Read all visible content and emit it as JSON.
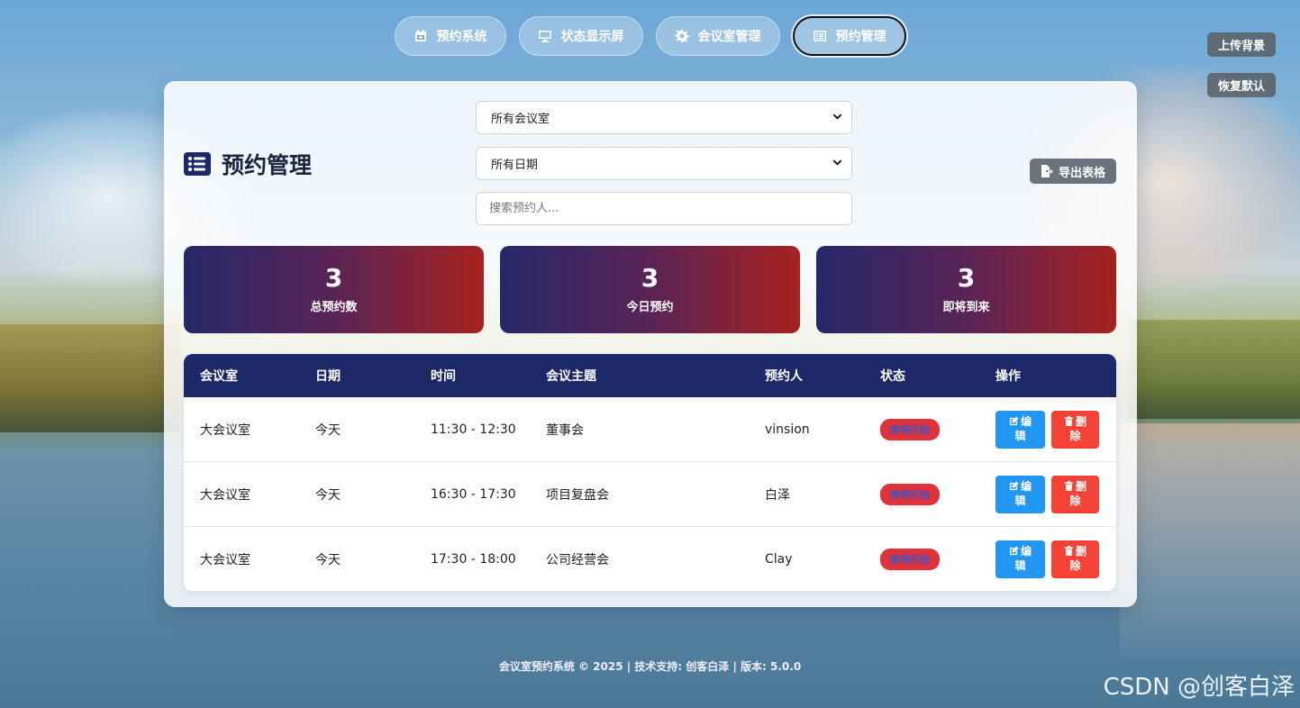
{
  "nav": {
    "items": [
      {
        "label": "预约系统",
        "icon": "calendar-icon"
      },
      {
        "label": "状态显示屏",
        "icon": "monitor-icon"
      },
      {
        "label": "会议室管理",
        "icon": "gear-icon"
      },
      {
        "label": "预约管理",
        "icon": "list-icon"
      }
    ],
    "active_index": 3
  },
  "corner": {
    "upload_bg": "上传背景",
    "restore_default": "恢复默认"
  },
  "header": {
    "title": "预约管理",
    "title_icon": "list-icon"
  },
  "filters": {
    "room_select": "所有会议室",
    "date_select": "所有日期",
    "search_placeholder": "搜索预约人..."
  },
  "export": {
    "label": "导出表格",
    "icon": "file-export-icon"
  },
  "stats": [
    {
      "value": "3",
      "label": "总预约数"
    },
    {
      "value": "3",
      "label": "今日预约"
    },
    {
      "value": "3",
      "label": "即将到来"
    }
  ],
  "table": {
    "headers": [
      "会议室",
      "日期",
      "时间",
      "会议主题",
      "预约人",
      "状态",
      "操作"
    ],
    "rows": [
      {
        "room": "大会议室",
        "date": "今天",
        "time": "11:30 - 12:30",
        "topic": "董事会",
        "booker": "vinsion",
        "status": "即将开始"
      },
      {
        "room": "大会议室",
        "date": "今天",
        "time": "16:30 - 17:30",
        "topic": "项目复盘会",
        "booker": "白泽",
        "status": "即将开始"
      },
      {
        "room": "大会议室",
        "date": "今天",
        "time": "17:30 - 18:00",
        "topic": "公司经营会",
        "booker": "Clay",
        "status": "即将开始"
      }
    ],
    "edit_label_top": "编",
    "edit_label_bottom": "辑",
    "delete_label_top": "删",
    "delete_label_bottom": "除"
  },
  "footer": "会议室预约系统 © 2025 | 技术支持: 创客白泽 | 版本: 5.0.0",
  "watermark": "CSDN @创客白泽",
  "colors": {
    "header_bg": "#1c2868",
    "edit": "#2196f3",
    "delete": "#f44336",
    "badge": "#e0323a",
    "stat_gradient_start": "#26286a",
    "stat_gradient_end": "#a8221f"
  }
}
